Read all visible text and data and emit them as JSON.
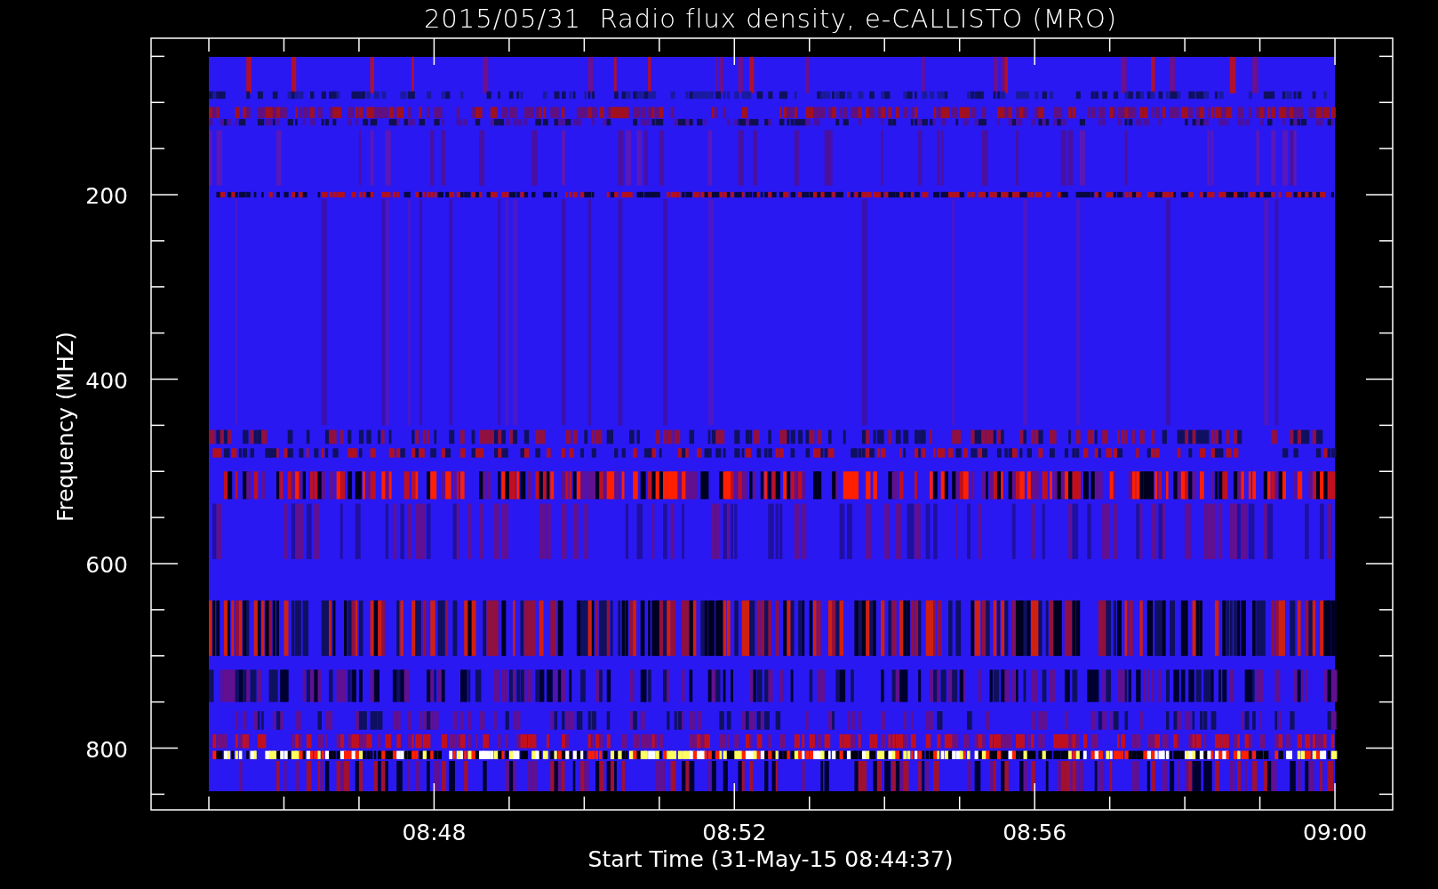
{
  "title": "2015/05/31  Radio flux density, e-CALLISTO (MRO)",
  "y_axis": {
    "title": "Frequency (MHZ)",
    "tick_labels": [
      "200",
      "400",
      "600",
      "800"
    ]
  },
  "x_axis": {
    "title": "Start Time (31-May-15 08:44:37)",
    "tick_labels": [
      "08:48",
      "08:52",
      "08:56",
      "09:00"
    ]
  }
}
